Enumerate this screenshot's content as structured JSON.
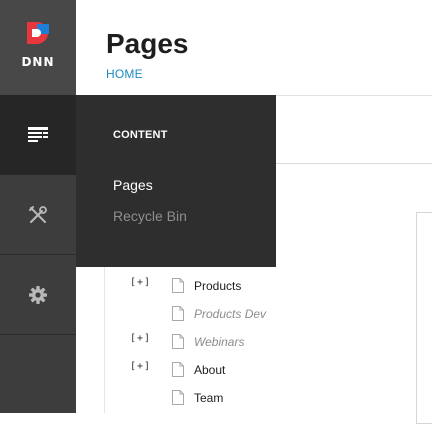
{
  "logo": {
    "wordmark": "DNN"
  },
  "header": {
    "title": "Pages",
    "breadcrumb": "HOME"
  },
  "rail": {
    "items": [
      {
        "icon": "content-icon",
        "active": true
      },
      {
        "icon": "tools-icon",
        "active": false
      },
      {
        "icon": "gear-icon",
        "active": false
      }
    ]
  },
  "flyout": {
    "heading": "CONTENT",
    "items": [
      {
        "label": "Pages"
      },
      {
        "label": "Recycle Bin"
      }
    ]
  },
  "tree": {
    "rows": [
      {
        "toggle": "[+]",
        "label": "Products",
        "muted": false
      },
      {
        "toggle": "",
        "label": "Products Dev",
        "muted": true
      },
      {
        "toggle": "[+]",
        "label": "Webinars",
        "muted": true
      },
      {
        "toggle": "[+]",
        "label": "About",
        "muted": false
      },
      {
        "toggle": "",
        "label": "Team",
        "muted": false
      }
    ]
  },
  "colors": {
    "accent": "#1e88c3",
    "rail": "#3d3d3d",
    "flyout": "#2e2e2e",
    "logo_red": "#e8363d",
    "logo_blue": "#1e7fd9"
  }
}
